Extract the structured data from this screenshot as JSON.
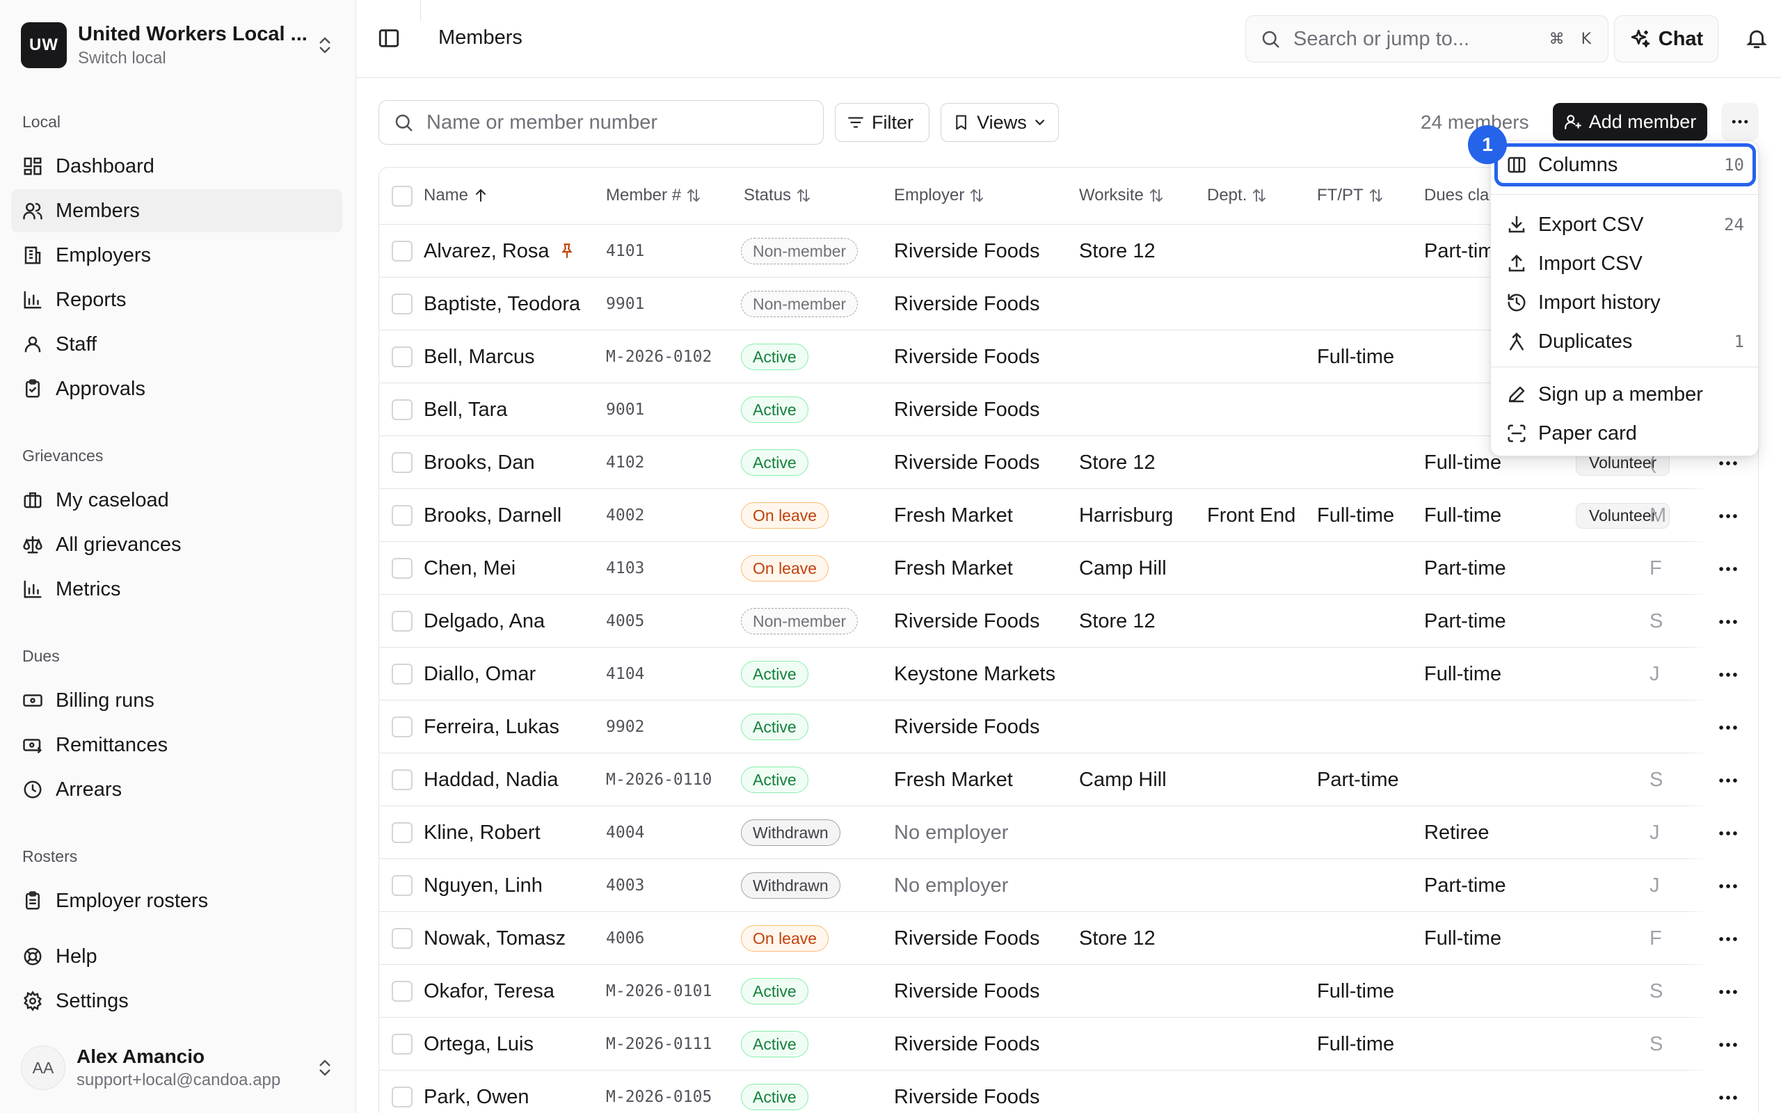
{
  "org": {
    "initials": "UW",
    "name": "United Workers Local ...",
    "subtitle": "Switch local"
  },
  "nav": {
    "local": {
      "title": "Local",
      "items": [
        "Dashboard",
        "Members",
        "Employers",
        "Reports",
        "Staff",
        "Approvals"
      ]
    },
    "grievances": {
      "title": "Grievances",
      "items": [
        "My caseload",
        "All grievances",
        "Metrics"
      ]
    },
    "dues": {
      "title": "Dues",
      "items": [
        "Billing runs",
        "Remittances",
        "Arrears"
      ]
    },
    "rosters": {
      "title": "Rosters",
      "items": [
        "Employer rosters"
      ]
    },
    "bottom": [
      "Help",
      "Settings"
    ]
  },
  "user": {
    "initials": "AA",
    "name": "Alex Amancio",
    "email": "support+local@candoa.app"
  },
  "topbar": {
    "title": "Members",
    "search_placeholder": "Search or jump to...",
    "shortcut_cmd": "⌘",
    "shortcut_key": "K",
    "chat_label": "Chat"
  },
  "toolbar": {
    "filter_placeholder": "Name or member number",
    "filter_label": "Filter",
    "views_label": "Views",
    "count": "24 members",
    "add_label": "Add member"
  },
  "table": {
    "headers": [
      "Name",
      "Member #",
      "Status",
      "Employer",
      "Worksite",
      "Dept.",
      "FT/PT",
      "Dues cla"
    ],
    "rows": [
      {
        "name": "Alvarez, Rosa",
        "num": "4101",
        "status": "Non-member",
        "employer": "Riverside Foods",
        "worksite": "Store 12",
        "dept": "",
        "ftpt": "",
        "dues": "Part-tim",
        "tag": "",
        "extra": ""
      },
      {
        "name": "Baptiste, Teodora",
        "num": "9901",
        "status": "Non-member",
        "employer": "Riverside Foods",
        "worksite": "",
        "dept": "",
        "ftpt": "",
        "dues": "",
        "tag": "",
        "extra": ""
      },
      {
        "name": "Bell, Marcus",
        "num": "M-2026-0102",
        "status": "Active",
        "employer": "Riverside Foods",
        "worksite": "",
        "dept": "",
        "ftpt": "Full-time",
        "dues": "",
        "tag": "",
        "extra": ""
      },
      {
        "name": "Bell, Tara",
        "num": "9001",
        "status": "Active",
        "employer": "Riverside Foods",
        "worksite": "",
        "dept": "",
        "ftpt": "",
        "dues": "",
        "tag": "",
        "extra": ""
      },
      {
        "name": "Brooks, Dan",
        "num": "4102",
        "status": "Active",
        "employer": "Riverside Foods",
        "worksite": "Store 12",
        "dept": "",
        "ftpt": "",
        "dues": "Full-time",
        "tag": "Volunteer",
        "extra": "("
      },
      {
        "name": "Brooks, Darnell",
        "num": "4002",
        "status": "On leave",
        "employer": "Fresh Market",
        "worksite": "Harrisburg",
        "dept": "Front End",
        "ftpt": "Full-time",
        "dues": "Full-time",
        "tag": "Volunteer",
        "extra": "M"
      },
      {
        "name": "Chen, Mei",
        "num": "4103",
        "status": "On leave",
        "employer": "Fresh Market",
        "worksite": "Camp Hill",
        "dept": "",
        "ftpt": "",
        "dues": "Part-time",
        "tag": "",
        "extra": "F"
      },
      {
        "name": "Delgado, Ana",
        "num": "4005",
        "status": "Non-member",
        "employer": "Riverside Foods",
        "worksite": "Store 12",
        "dept": "",
        "ftpt": "",
        "dues": "Part-time",
        "tag": "",
        "extra": "S"
      },
      {
        "name": "Diallo, Omar",
        "num": "4104",
        "status": "Active",
        "employer": "Keystone Markets",
        "worksite": "",
        "dept": "",
        "ftpt": "",
        "dues": "Full-time",
        "tag": "",
        "extra": "J"
      },
      {
        "name": "Ferreira, Lukas",
        "num": "9902",
        "status": "Active",
        "employer": "Riverside Foods",
        "worksite": "",
        "dept": "",
        "ftpt": "",
        "dues": "",
        "tag": "",
        "extra": ""
      },
      {
        "name": "Haddad, Nadia",
        "num": "M-2026-0110",
        "status": "Active",
        "employer": "Fresh Market",
        "worksite": "Camp Hill",
        "dept": "",
        "ftpt": "Part-time",
        "dues": "",
        "tag": "",
        "extra": "S"
      },
      {
        "name": "Kline, Robert",
        "num": "4004",
        "status": "Withdrawn",
        "employer": "No employer",
        "worksite": "",
        "dept": "",
        "ftpt": "",
        "dues": "Retiree",
        "tag": "",
        "extra": "J"
      },
      {
        "name": "Nguyen, Linh",
        "num": "4003",
        "status": "Withdrawn",
        "employer": "No employer",
        "worksite": "",
        "dept": "",
        "ftpt": "",
        "dues": "Part-time",
        "tag": "",
        "extra": "J"
      },
      {
        "name": "Nowak, Tomasz",
        "num": "4006",
        "status": "On leave",
        "employer": "Riverside Foods",
        "worksite": "Store 12",
        "dept": "",
        "ftpt": "",
        "dues": "Full-time",
        "tag": "",
        "extra": "F"
      },
      {
        "name": "Okafor, Teresa",
        "num": "M-2026-0101",
        "status": "Active",
        "employer": "Riverside Foods",
        "worksite": "",
        "dept": "",
        "ftpt": "Full-time",
        "dues": "",
        "tag": "",
        "extra": "S"
      },
      {
        "name": "Ortega, Luis",
        "num": "M-2026-0111",
        "status": "Active",
        "employer": "Riverside Foods",
        "worksite": "",
        "dept": "",
        "ftpt": "Full-time",
        "dues": "",
        "tag": "",
        "extra": "S"
      },
      {
        "name": "Park, Owen",
        "num": "M-2026-0105",
        "status": "Active",
        "employer": "Riverside Foods",
        "worksite": "",
        "dept": "",
        "ftpt": "",
        "dues": "",
        "tag": "",
        "extra": ""
      }
    ]
  },
  "dropdown": {
    "step": "1",
    "items": [
      {
        "label": "Columns",
        "count": "10",
        "icon": "columns-icon"
      },
      {
        "label": "Export CSV",
        "count": "24",
        "icon": "download-icon"
      },
      {
        "label": "Import CSV",
        "count": "",
        "icon": "upload-icon"
      },
      {
        "label": "Import history",
        "count": "",
        "icon": "history-icon"
      },
      {
        "label": "Duplicates",
        "count": "1",
        "icon": "merge-icon"
      },
      {
        "label": "Sign up a member",
        "count": "",
        "icon": "pen-icon"
      },
      {
        "label": "Paper card",
        "count": "",
        "icon": "scan-icon"
      }
    ]
  },
  "colors": {
    "accent": "#2563eb",
    "primary": "#18181b",
    "active": "#15803d",
    "on_leave": "#c2410c"
  }
}
